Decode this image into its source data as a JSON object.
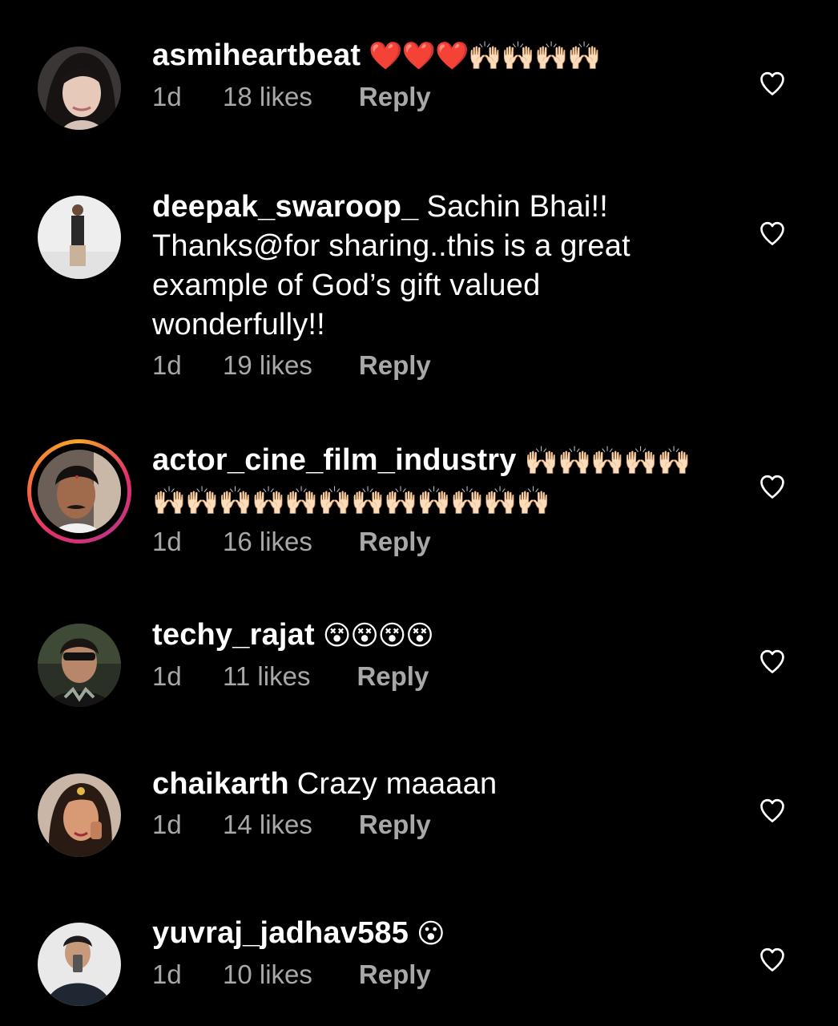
{
  "comments": [
    {
      "username": "asmiheartbeat",
      "text": "",
      "emoji": "❤️❤️❤️🙌🏻🙌🏻🙌🏻🙌🏻",
      "time": "1d",
      "likes": "18 likes",
      "reply": "Reply",
      "has_story": false
    },
    {
      "username": "deepak_swaroop_",
      "text": "Sachin Bhai!! Thanks@for sharing..this is a great example of God’s gift valued wonderfully!!",
      "emoji": "",
      "time": "1d",
      "likes": "19 likes",
      "reply": "Reply",
      "has_story": false
    },
    {
      "username": "actor_cine_film_industry",
      "text": "",
      "emoji": "🙌🏻🙌🏻🙌🏻🙌🏻🙌🏻🙌🏻🙌🏻🙌🏻🙌🏻🙌🏻🙌🏻🙌🏻🙌🏻🙌🏻🙌🏻🙌🏻🙌🏻",
      "time": "1d",
      "likes": "16 likes",
      "reply": "Reply",
      "has_story": true
    },
    {
      "username": "techy_rajat",
      "text": "",
      "emoji": "😵😵😵😵",
      "time": "1d",
      "likes": "11 likes",
      "reply": "Reply",
      "has_story": false
    },
    {
      "username": "chaikarth",
      "text": "Crazy maaaan",
      "emoji": "",
      "time": "1d",
      "likes": "14 likes",
      "reply": "Reply",
      "has_story": false
    },
    {
      "username": "yuvraj_jadhav585",
      "text": "",
      "emoji": "😮",
      "time": "1d",
      "likes": "10 likes",
      "reply": "Reply",
      "has_story": false
    }
  ],
  "colors": {
    "background": "#000000",
    "text": "#ffffff",
    "meta": "#a8a8a8",
    "story_ring": "#e1306c"
  },
  "icons": {
    "like": "heart-outline-icon"
  }
}
